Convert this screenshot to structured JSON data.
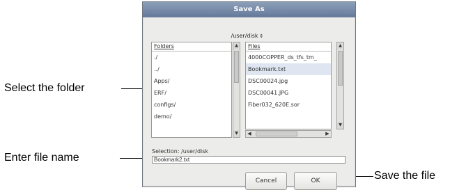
{
  "dialog": {
    "title": "Save As",
    "directory": "/user/disk",
    "directory_arrow": "⇕",
    "folders": {
      "header": "Folders",
      "items": [
        "./",
        "../",
        "Apps/",
        "ERF/",
        "configs/",
        "demo/"
      ]
    },
    "files": {
      "header": "Files",
      "items": [
        "4000COPPER_ds_tfs_tm_",
        "Bookmark.txt",
        "DSC00024.jpg",
        "DSC00041.JPG",
        "Fiber032_620E.sor"
      ],
      "selected_index": 1
    },
    "selection_label": "Selection: /user/disk",
    "filename_value": "Bookmark2.txt",
    "cancel_label": "Cancel",
    "ok_label": "OK"
  },
  "annotations": {
    "select_folder": "Select the folder",
    "enter_file_name": "Enter file name",
    "save_file": "Save the file"
  }
}
